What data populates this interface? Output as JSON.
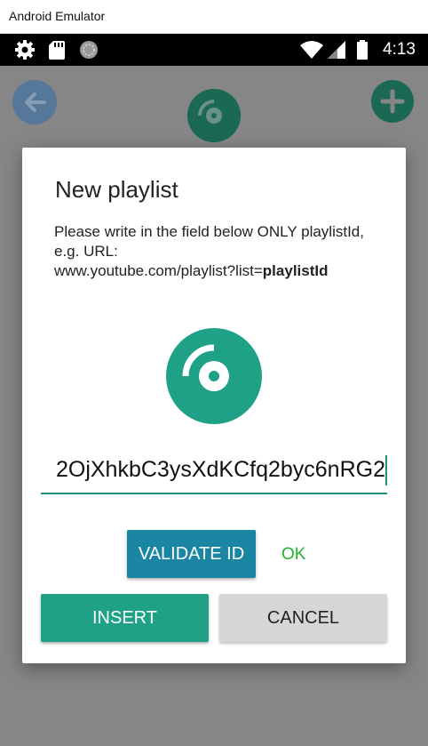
{
  "window": {
    "title": "Android Emulator"
  },
  "status_bar": {
    "time": "4:13",
    "icons": [
      "gear-icon",
      "sd-card-icon",
      "sync-icon",
      "wifi-icon",
      "cell-signal-icon",
      "battery-icon"
    ]
  },
  "app_bar": {
    "icons": [
      "back-arrow-icon",
      "disc-icon",
      "plus-icon"
    ]
  },
  "dialog": {
    "title": "New playlist",
    "message_line1": "Please write in the field below ONLY playlistId, e.g. URL:",
    "message_url_prefix": "www.youtube.com/playlist?list=",
    "message_url_bold": "playlistId",
    "icon": "disc-icon",
    "input_value": "2OjXhkbC3ysXdKCfq2byc6nRG2",
    "validate_label": "VALIDATE ID",
    "status_label": "OK",
    "insert_label": "INSERT",
    "cancel_label": "CANCEL"
  },
  "colors": {
    "teal": "#1ea187",
    "validate_blue": "#1a86a4",
    "ok_green": "#22b22e",
    "cancel_gray": "#d6d6d6"
  }
}
